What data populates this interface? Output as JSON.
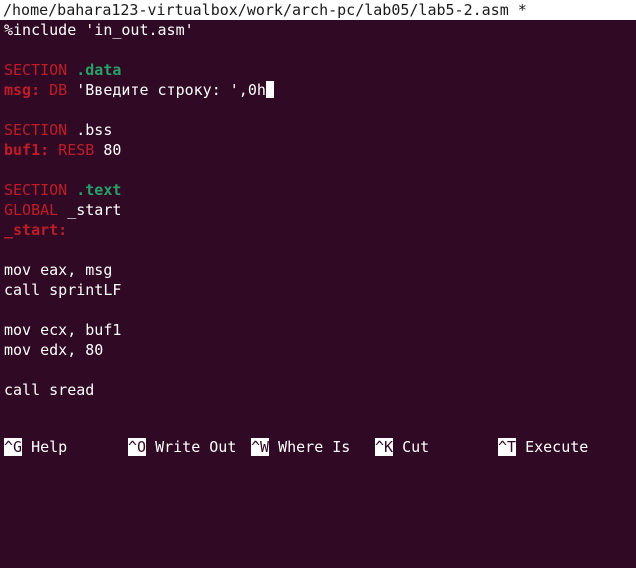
{
  "window": {
    "title": "/home/bahara123-virtualbox/work/arch-pc/lab05/lab5-2.asm *"
  },
  "editor": {
    "include": "%include 'in_out.asm'",
    "section_kw": "SECTION",
    "data_name": ".data",
    "msg_label": "msg:",
    "db_kw": "DB",
    "msg_value": " 'Введите строку: ',0h",
    "bss_name": ".bss",
    "buf_label": "buf1:",
    "resb_kw": "RESB",
    "buf_size": " 80",
    "text_name": ".text",
    "global_kw": "GLOBAL",
    "global_symbol": " _start",
    "start_label": "_start:",
    "line_mov_eax": "mov eax, msg",
    "line_call_sprint": "call sprintLF",
    "line_mov_ecx": "mov ecx, buf1",
    "line_mov_edx": "mov edx, 80",
    "line_call_sread": "call sread"
  },
  "shortcuts": [
    {
      "key": "^G",
      "label": " Help"
    },
    {
      "key": "^O",
      "label": " Write Out"
    },
    {
      "key": "^W",
      "label": " Where Is"
    },
    {
      "key": "^K",
      "label": " Cut"
    },
    {
      "key": "^T",
      "label": " Execute"
    }
  ],
  "colors": {
    "background": "#300a24",
    "keyword_red": "#c01c28",
    "section_green": "#26a269",
    "foreground": "#ffffff"
  }
}
